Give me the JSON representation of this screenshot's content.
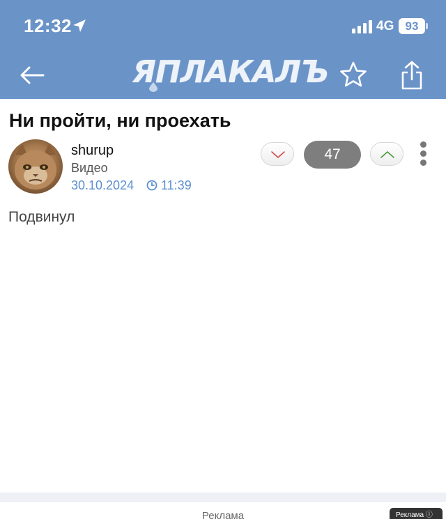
{
  "status_bar": {
    "time": "12:32",
    "network": "4G",
    "battery": "93",
    "icons": [
      "location-arrow-icon",
      "signal-bars-icon",
      "battery-icon"
    ]
  },
  "nav": {
    "logo_text": "ЯПЛАКАЛЪ",
    "icons": [
      "back-arrow-icon",
      "star-icon",
      "share-icon"
    ],
    "accent_color": "#6a93c8"
  },
  "post": {
    "title": "Ни пройти, ни проехать",
    "author": "shurup",
    "category": "Видео",
    "date": "30.10.2024",
    "time": "11:39",
    "score": "47",
    "body": "Подвинул",
    "link_color": "#5b8fcf"
  },
  "footer": {
    "ad_label": "Реклама",
    "ad_badge": "Реклама"
  }
}
